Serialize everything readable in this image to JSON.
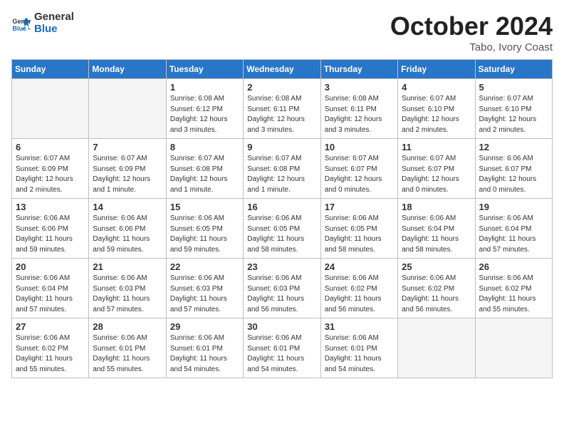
{
  "header": {
    "logo_line1": "General",
    "logo_line2": "Blue",
    "month": "October 2024",
    "location": "Tabo, Ivory Coast"
  },
  "weekdays": [
    "Sunday",
    "Monday",
    "Tuesday",
    "Wednesday",
    "Thursday",
    "Friday",
    "Saturday"
  ],
  "weeks": [
    [
      {
        "day": "",
        "empty": true
      },
      {
        "day": "",
        "empty": true
      },
      {
        "day": "1",
        "sunrise": "6:08 AM",
        "sunset": "6:12 PM",
        "daylight": "12 hours and 3 minutes."
      },
      {
        "day": "2",
        "sunrise": "6:08 AM",
        "sunset": "6:11 PM",
        "daylight": "12 hours and 3 minutes."
      },
      {
        "day": "3",
        "sunrise": "6:08 AM",
        "sunset": "6:11 PM",
        "daylight": "12 hours and 3 minutes."
      },
      {
        "day": "4",
        "sunrise": "6:07 AM",
        "sunset": "6:10 PM",
        "daylight": "12 hours and 2 minutes."
      },
      {
        "day": "5",
        "sunrise": "6:07 AM",
        "sunset": "6:10 PM",
        "daylight": "12 hours and 2 minutes."
      }
    ],
    [
      {
        "day": "6",
        "sunrise": "6:07 AM",
        "sunset": "6:09 PM",
        "daylight": "12 hours and 2 minutes."
      },
      {
        "day": "7",
        "sunrise": "6:07 AM",
        "sunset": "6:09 PM",
        "daylight": "12 hours and 1 minute."
      },
      {
        "day": "8",
        "sunrise": "6:07 AM",
        "sunset": "6:08 PM",
        "daylight": "12 hours and 1 minute."
      },
      {
        "day": "9",
        "sunrise": "6:07 AM",
        "sunset": "6:08 PM",
        "daylight": "12 hours and 1 minute."
      },
      {
        "day": "10",
        "sunrise": "6:07 AM",
        "sunset": "6:07 PM",
        "daylight": "12 hours and 0 minutes."
      },
      {
        "day": "11",
        "sunrise": "6:07 AM",
        "sunset": "6:07 PM",
        "daylight": "12 hours and 0 minutes."
      },
      {
        "day": "12",
        "sunrise": "6:06 AM",
        "sunset": "6:07 PM",
        "daylight": "12 hours and 0 minutes."
      }
    ],
    [
      {
        "day": "13",
        "sunrise": "6:06 AM",
        "sunset": "6:06 PM",
        "daylight": "11 hours and 59 minutes."
      },
      {
        "day": "14",
        "sunrise": "6:06 AM",
        "sunset": "6:06 PM",
        "daylight": "11 hours and 59 minutes."
      },
      {
        "day": "15",
        "sunrise": "6:06 AM",
        "sunset": "6:05 PM",
        "daylight": "11 hours and 59 minutes."
      },
      {
        "day": "16",
        "sunrise": "6:06 AM",
        "sunset": "6:05 PM",
        "daylight": "11 hours and 58 minutes."
      },
      {
        "day": "17",
        "sunrise": "6:06 AM",
        "sunset": "6:05 PM",
        "daylight": "11 hours and 58 minutes."
      },
      {
        "day": "18",
        "sunrise": "6:06 AM",
        "sunset": "6:04 PM",
        "daylight": "11 hours and 58 minutes."
      },
      {
        "day": "19",
        "sunrise": "6:06 AM",
        "sunset": "6:04 PM",
        "daylight": "11 hours and 57 minutes."
      }
    ],
    [
      {
        "day": "20",
        "sunrise": "6:06 AM",
        "sunset": "6:04 PM",
        "daylight": "11 hours and 57 minutes."
      },
      {
        "day": "21",
        "sunrise": "6:06 AM",
        "sunset": "6:03 PM",
        "daylight": "11 hours and 57 minutes."
      },
      {
        "day": "22",
        "sunrise": "6:06 AM",
        "sunset": "6:03 PM",
        "daylight": "11 hours and 57 minutes."
      },
      {
        "day": "23",
        "sunrise": "6:06 AM",
        "sunset": "6:03 PM",
        "daylight": "11 hours and 56 minutes."
      },
      {
        "day": "24",
        "sunrise": "6:06 AM",
        "sunset": "6:02 PM",
        "daylight": "11 hours and 56 minutes."
      },
      {
        "day": "25",
        "sunrise": "6:06 AM",
        "sunset": "6:02 PM",
        "daylight": "11 hours and 56 minutes."
      },
      {
        "day": "26",
        "sunrise": "6:06 AM",
        "sunset": "6:02 PM",
        "daylight": "11 hours and 55 minutes."
      }
    ],
    [
      {
        "day": "27",
        "sunrise": "6:06 AM",
        "sunset": "6:02 PM",
        "daylight": "11 hours and 55 minutes."
      },
      {
        "day": "28",
        "sunrise": "6:06 AM",
        "sunset": "6:01 PM",
        "daylight": "11 hours and 55 minutes."
      },
      {
        "day": "29",
        "sunrise": "6:06 AM",
        "sunset": "6:01 PM",
        "daylight": "11 hours and 54 minutes."
      },
      {
        "day": "30",
        "sunrise": "6:06 AM",
        "sunset": "6:01 PM",
        "daylight": "11 hours and 54 minutes."
      },
      {
        "day": "31",
        "sunrise": "6:06 AM",
        "sunset": "6:01 PM",
        "daylight": "11 hours and 54 minutes."
      },
      {
        "day": "",
        "empty": true
      },
      {
        "day": "",
        "empty": true
      }
    ]
  ]
}
